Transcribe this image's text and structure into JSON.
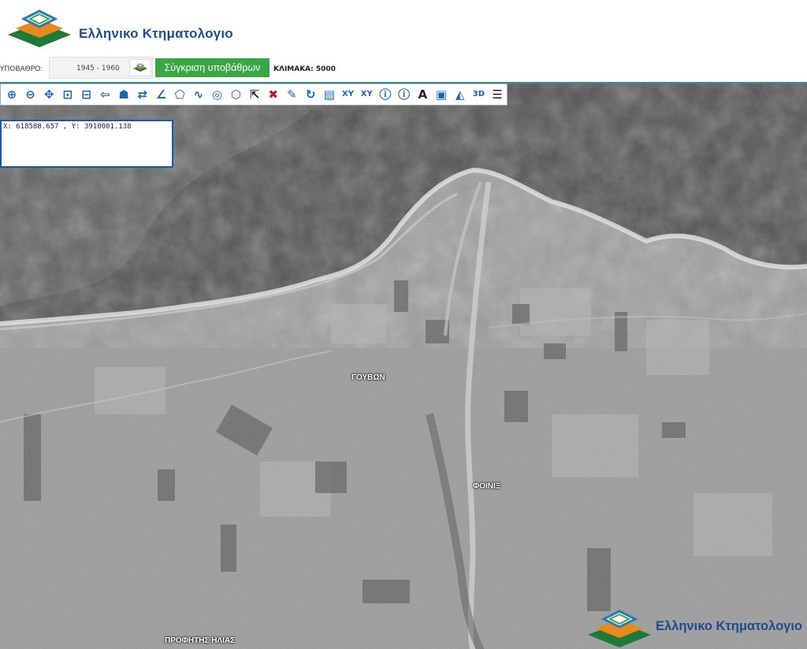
{
  "header": {
    "logo_text": "Ελληνικο Κτηματολογιο"
  },
  "basemap_bar": {
    "label": "ΥΠΟΒΑΘΡΟ:",
    "selected_value": "1945 - 1960",
    "compare_button": "Σύγκριση υποβάθρων",
    "scale_text": "ΚΛΙΜΑΚΑ: 5000"
  },
  "toolbar": {
    "tools": [
      {
        "icon": "zoom-in-icon",
        "glyph": "⊕"
      },
      {
        "icon": "zoom-out-icon",
        "glyph": "⊖"
      },
      {
        "icon": "pan-icon",
        "glyph": "✥"
      },
      {
        "icon": "zoom-window-icon",
        "glyph": "⊡"
      },
      {
        "icon": "zoom-extent-icon",
        "glyph": "⊟"
      },
      {
        "icon": "previous-view-icon",
        "glyph": "⇦"
      },
      {
        "icon": "locate-icon",
        "glyph": "☗"
      },
      {
        "icon": "measure-distance-icon",
        "glyph": "⇄"
      },
      {
        "icon": "measure-angle-icon",
        "glyph": "∠"
      },
      {
        "icon": "draw-polygon-icon",
        "glyph": "⬠"
      },
      {
        "icon": "draw-line-icon",
        "glyph": "∿"
      },
      {
        "icon": "draw-circle-icon",
        "glyph": "◎"
      },
      {
        "icon": "select-polygon-icon",
        "glyph": "⬡"
      },
      {
        "icon": "select-arrow-icon",
        "glyph": "⇱"
      },
      {
        "icon": "clear-icon",
        "glyph": "✖"
      },
      {
        "icon": "edit-pencil-icon",
        "glyph": "✎"
      },
      {
        "icon": "refresh-icon",
        "glyph": "↻"
      },
      {
        "icon": "document-icon",
        "glyph": "▤"
      },
      {
        "icon": "xy-input-icon",
        "glyph": "XY"
      },
      {
        "icon": "xy-goto-icon",
        "glyph": "XY"
      },
      {
        "icon": "info-icon",
        "glyph": "ⓘ"
      },
      {
        "icon": "info-detail-icon",
        "glyph": "ⓘ"
      },
      {
        "icon": "text-label-icon",
        "glyph": "A"
      },
      {
        "icon": "print-icon",
        "glyph": "▣"
      },
      {
        "icon": "shape-icon",
        "glyph": "◭"
      },
      {
        "icon": "3d-view-icon",
        "glyph": "3D"
      },
      {
        "icon": "layers-list-icon",
        "glyph": "☰"
      }
    ]
  },
  "coordinates": {
    "text": "X: 618588.657 , Y: 3910001.138"
  },
  "places": {
    "gouvon": "ΓΟΥΒΩΝ",
    "foinix": "ΦΟΙΝΙΞ",
    "profitis_ilias": "ΠΡΟΦΗΤΗΣ ΗΛΙΑΣ"
  },
  "watermark": {
    "text": "Ελληνικο Κτηματολογιο"
  },
  "colors": {
    "brand_blue": "#1d4d8f",
    "brand_green": "#3aa646",
    "brand_orange": "#e8891c",
    "tool_blue": "#1b63b8"
  }
}
